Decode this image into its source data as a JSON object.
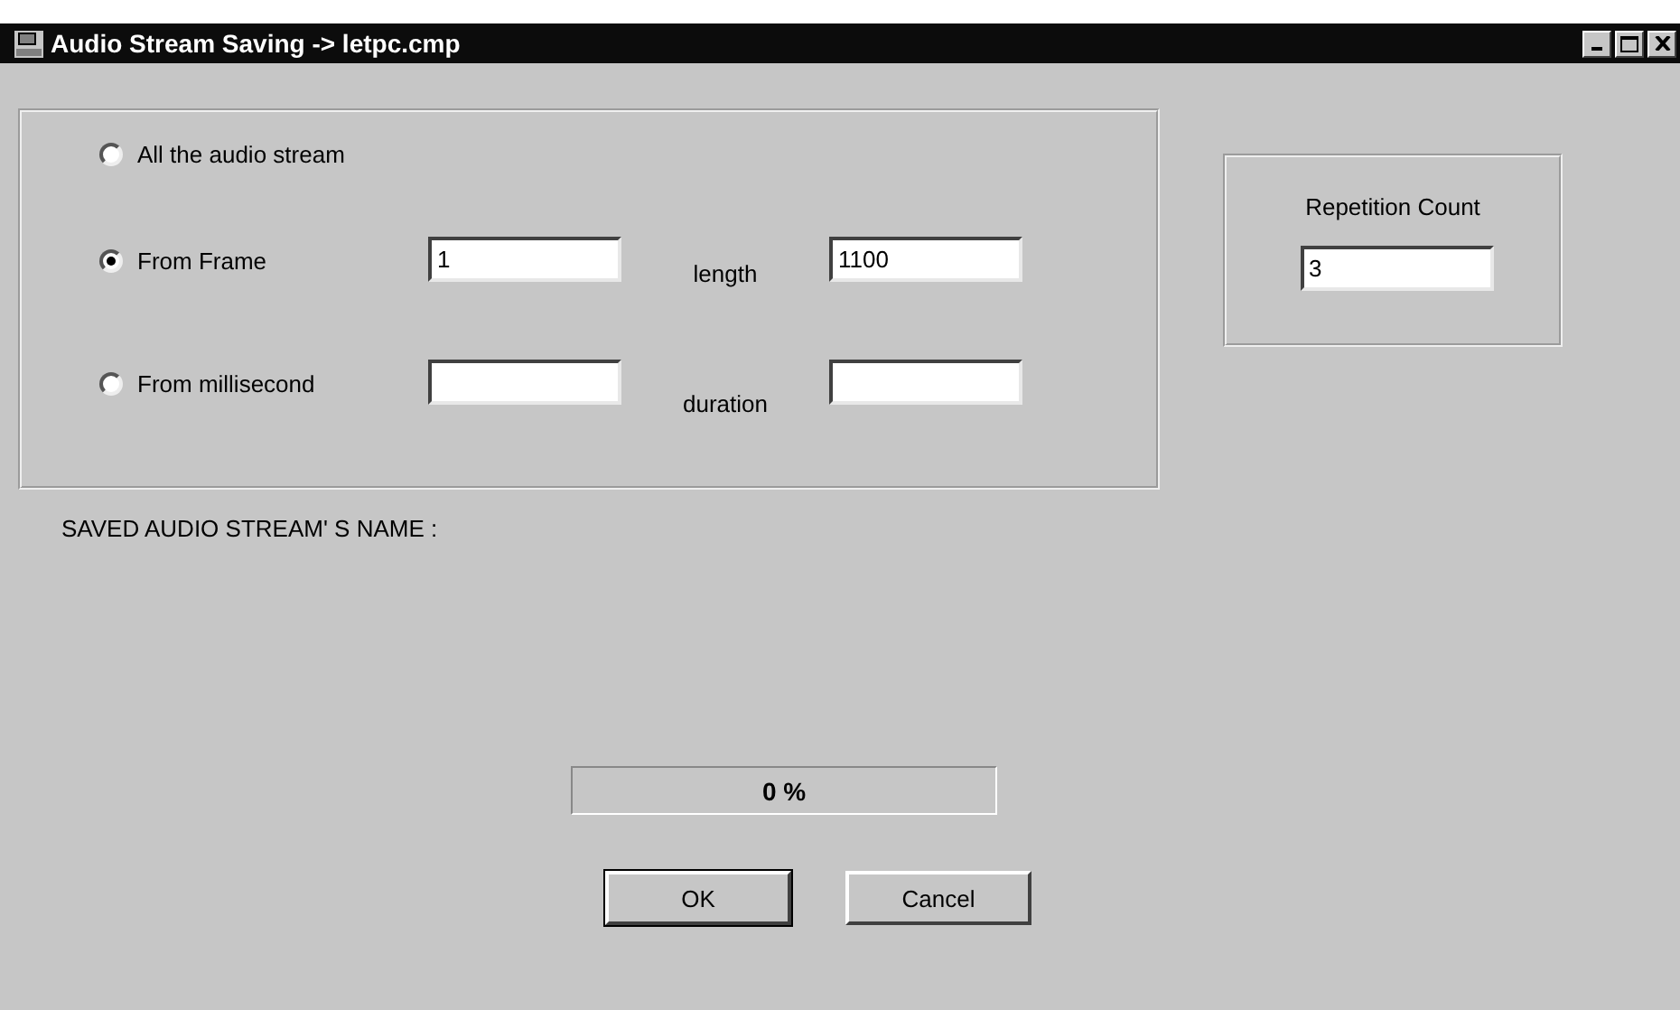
{
  "window": {
    "title": "Audio Stream Saving -> letpc.cmp"
  },
  "range_options": [
    {
      "kind": "plain",
      "label": "All the audio stream",
      "selected": false
    },
    {
      "kind": "range",
      "label": "From Frame",
      "selected": true,
      "start": "1",
      "extent_label": "length",
      "extent": "1100"
    },
    {
      "kind": "range",
      "label": "From millisecond",
      "selected": false,
      "extent_label": "duration"
    }
  ],
  "repetition": {
    "label": "Repetition Count",
    "value": "3"
  },
  "saved_name_label": "SAVED AUDIO STREAM' S NAME :",
  "progress": {
    "level": 0,
    "text": "0 %"
  },
  "buttons": [
    {
      "label": "OK",
      "default": true
    },
    {
      "label": "Cancel",
      "default": false
    }
  ]
}
